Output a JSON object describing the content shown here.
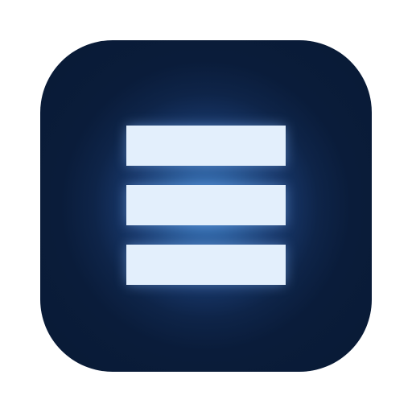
{
  "app_icon": {
    "icon_name": "hamburger-menu-icon",
    "bar_count": 3,
    "colors": {
      "page_background": "#ffffff",
      "tile_edge": "#081a35",
      "tile_glow_center": "#3d7cc4",
      "bar_fill": "#e3effc"
    }
  }
}
